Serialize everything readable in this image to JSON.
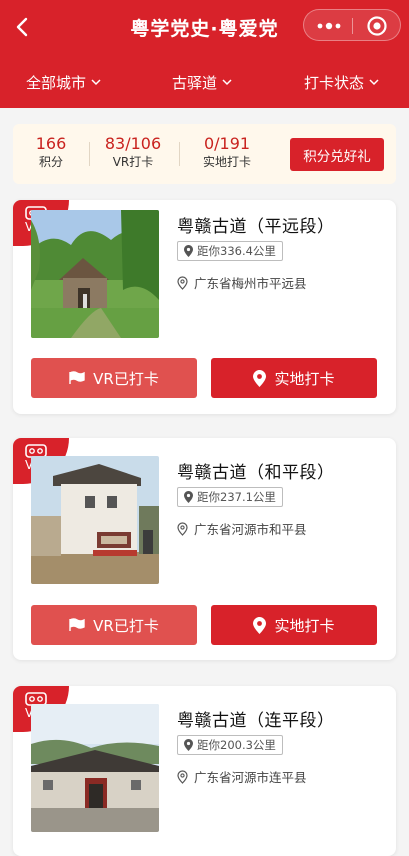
{
  "header": {
    "title": "粤学党史·粤爱党",
    "filters": [
      {
        "label": "全部城市"
      },
      {
        "label": "古驿道"
      },
      {
        "label": "打卡状态"
      }
    ],
    "bg_color": "#d8222a"
  },
  "stats": {
    "items": [
      {
        "value": "166",
        "label": "积分"
      },
      {
        "value": "83/106",
        "label": "VR打卡"
      },
      {
        "value": "0/191",
        "label": "实地打卡"
      }
    ],
    "redeem_label": "积分兑好礼"
  },
  "cards": [
    {
      "badge": "VR",
      "title": "粤赣古道（平远段）",
      "distance": "距你336.4公里",
      "location": "广东省梅州市平远县",
      "vr_label": "VR已打卡",
      "field_label": "实地打卡"
    },
    {
      "badge": "VR",
      "title": "粤赣古道（和平段）",
      "distance": "距你237.1公里",
      "location": "广东省河源市和平县",
      "vr_label": "VR已打卡",
      "field_label": "实地打卡"
    },
    {
      "badge": "VR",
      "title": "粤赣古道（连平段）",
      "distance": "距你200.3公里",
      "location": "广东省河源市连平县",
      "vr_label": "",
      "field_label": ""
    }
  ],
  "colors": {
    "accent": "#d8222a",
    "vr_button": "#e0514f",
    "stats_bg": "#fff8ec"
  }
}
